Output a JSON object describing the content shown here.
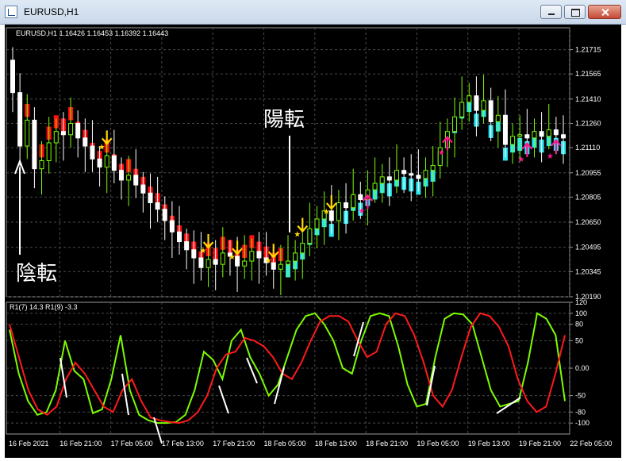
{
  "window": {
    "title": "EURUSD,H1"
  },
  "price_panel": {
    "header": "EURUSD,H1  1.16426 1.16453 1.16392 1.16443",
    "labels": {
      "reversal_down": "陰転",
      "reversal_up": "陽転"
    },
    "y_ticks": [
      "1.21715",
      "1.21565",
      "1.21410",
      "1.21260",
      "1.21110",
      "1.20955",
      "1.20805",
      "1.20650",
      "1.20495",
      "1.20345",
      "1.20190"
    ]
  },
  "indicator_panel": {
    "header": "R1(7) 14.3  R1(9) -3.3",
    "y_ticks": [
      "120",
      "100",
      "80",
      "50",
      "0.00",
      "-50",
      "-80",
      "-100"
    ]
  },
  "x_ticks": [
    "16 Feb 2021",
    "16 Feb 21:00",
    "17 Feb 05:00",
    "17 Feb 13:00",
    "17 Feb 21:00",
    "18 Feb 05:00",
    "18 Feb 13:00",
    "18 Feb 21:00",
    "19 Feb 05:00",
    "19 Feb 13:00",
    "19 Feb 21:00",
    "22 Feb 05:00"
  ],
  "colors": {
    "background": "#000000",
    "grid": "#4a4a4a",
    "bull_candle": "#7cfc00",
    "bear_candle": "#ffffff",
    "down_trend": "#ff1010",
    "up_trend": "#2ee6f0",
    "sell_arrow": "#ffd700",
    "buy_arrow": "#ff1493",
    "rsi_fast": "#7cfc00",
    "rsi_slow": "#ff1a1a"
  },
  "chart_data": [
    {
      "type": "candlestick",
      "title": "EURUSD,H1",
      "ylim": [
        1.2019,
        1.2185
      ],
      "ticks_y": [
        1.2019,
        1.20345,
        1.20495,
        1.2065,
        1.20805,
        1.20955,
        1.2111,
        1.2126,
        1.2141,
        1.21565,
        1.21715
      ],
      "closes": [
        1.2145,
        1.2112,
        1.2128,
        1.2098,
        1.2103,
        1.2114,
        1.2121,
        1.2119,
        1.2126,
        1.2117,
        1.2112,
        1.2104,
        1.2099,
        1.2106,
        1.2097,
        1.2091,
        1.2094,
        1.2088,
        1.2083,
        1.2077,
        1.2073,
        1.2066,
        1.2059,
        1.2053,
        1.2048,
        1.2043,
        1.2037,
        1.2042,
        1.2039,
        1.2046,
        1.2044,
        1.2038,
        1.2041,
        1.2047,
        1.2043,
        1.204,
        1.2036,
        1.2039,
        1.2041,
        1.2046,
        1.2052,
        1.2061,
        1.2067,
        1.2072,
        1.2066,
        1.2077,
        1.2074,
        1.2082,
        1.2079,
        1.2085,
        1.2089,
        1.2093,
        1.2091,
        1.2097,
        1.2095,
        1.2094,
        1.2092,
        1.2097,
        1.21,
        1.2111,
        1.2121,
        1.213,
        1.2139,
        1.2143,
        1.2134,
        1.214,
        1.2127,
        1.2131,
        1.2113,
        1.2118,
        1.2119,
        1.2117,
        1.2121,
        1.2118,
        1.2122,
        1.2119,
        1.2117
      ],
      "ribbon_down_until_index": 37,
      "sell_signal_indices": [
        13,
        27,
        31,
        36,
        40,
        44
      ],
      "buy_signal_indices": [
        49,
        60,
        71,
        75
      ]
    },
    {
      "type": "line",
      "title": "R1(7) 14.3  R1(9) -3.3",
      "ylim": [
        -120,
        120
      ],
      "ticks_y": [
        120,
        100,
        80,
        50,
        0,
        -50,
        -80,
        -100
      ],
      "series": [
        {
          "name": "R1(7)",
          "values": [
            70,
            -10,
            -60,
            -85,
            -80,
            -40,
            50,
            -5,
            -20,
            -82,
            -75,
            -20,
            60,
            -40,
            -85,
            -95,
            -100,
            -100,
            -98,
            -85,
            -40,
            30,
            15,
            -20,
            50,
            70,
            20,
            -10,
            -50,
            -30,
            20,
            70,
            95,
            100,
            80,
            50,
            0,
            -10,
            50,
            95,
            100,
            95,
            40,
            -30,
            -70,
            -65,
            20,
            90,
            100,
            98,
            80,
            20,
            -40,
            -70,
            -65,
            -60,
            10,
            100,
            90,
            60,
            -60
          ]
        },
        {
          "name": "R1(9)",
          "values": [
            80,
            20,
            -40,
            -75,
            -85,
            -70,
            -20,
            10,
            -10,
            -40,
            -70,
            -80,
            -40,
            -20,
            -60,
            -90,
            -95,
            -98,
            -100,
            -95,
            -80,
            -50,
            0,
            25,
            30,
            55,
            50,
            40,
            20,
            -10,
            -20,
            10,
            50,
            85,
            95,
            95,
            85,
            50,
            20,
            30,
            80,
            100,
            95,
            60,
            10,
            -50,
            -70,
            -40,
            20,
            75,
            100,
            95,
            75,
            40,
            -20,
            -60,
            -80,
            -70,
            -10,
            60
          ]
        }
      ]
    }
  ]
}
